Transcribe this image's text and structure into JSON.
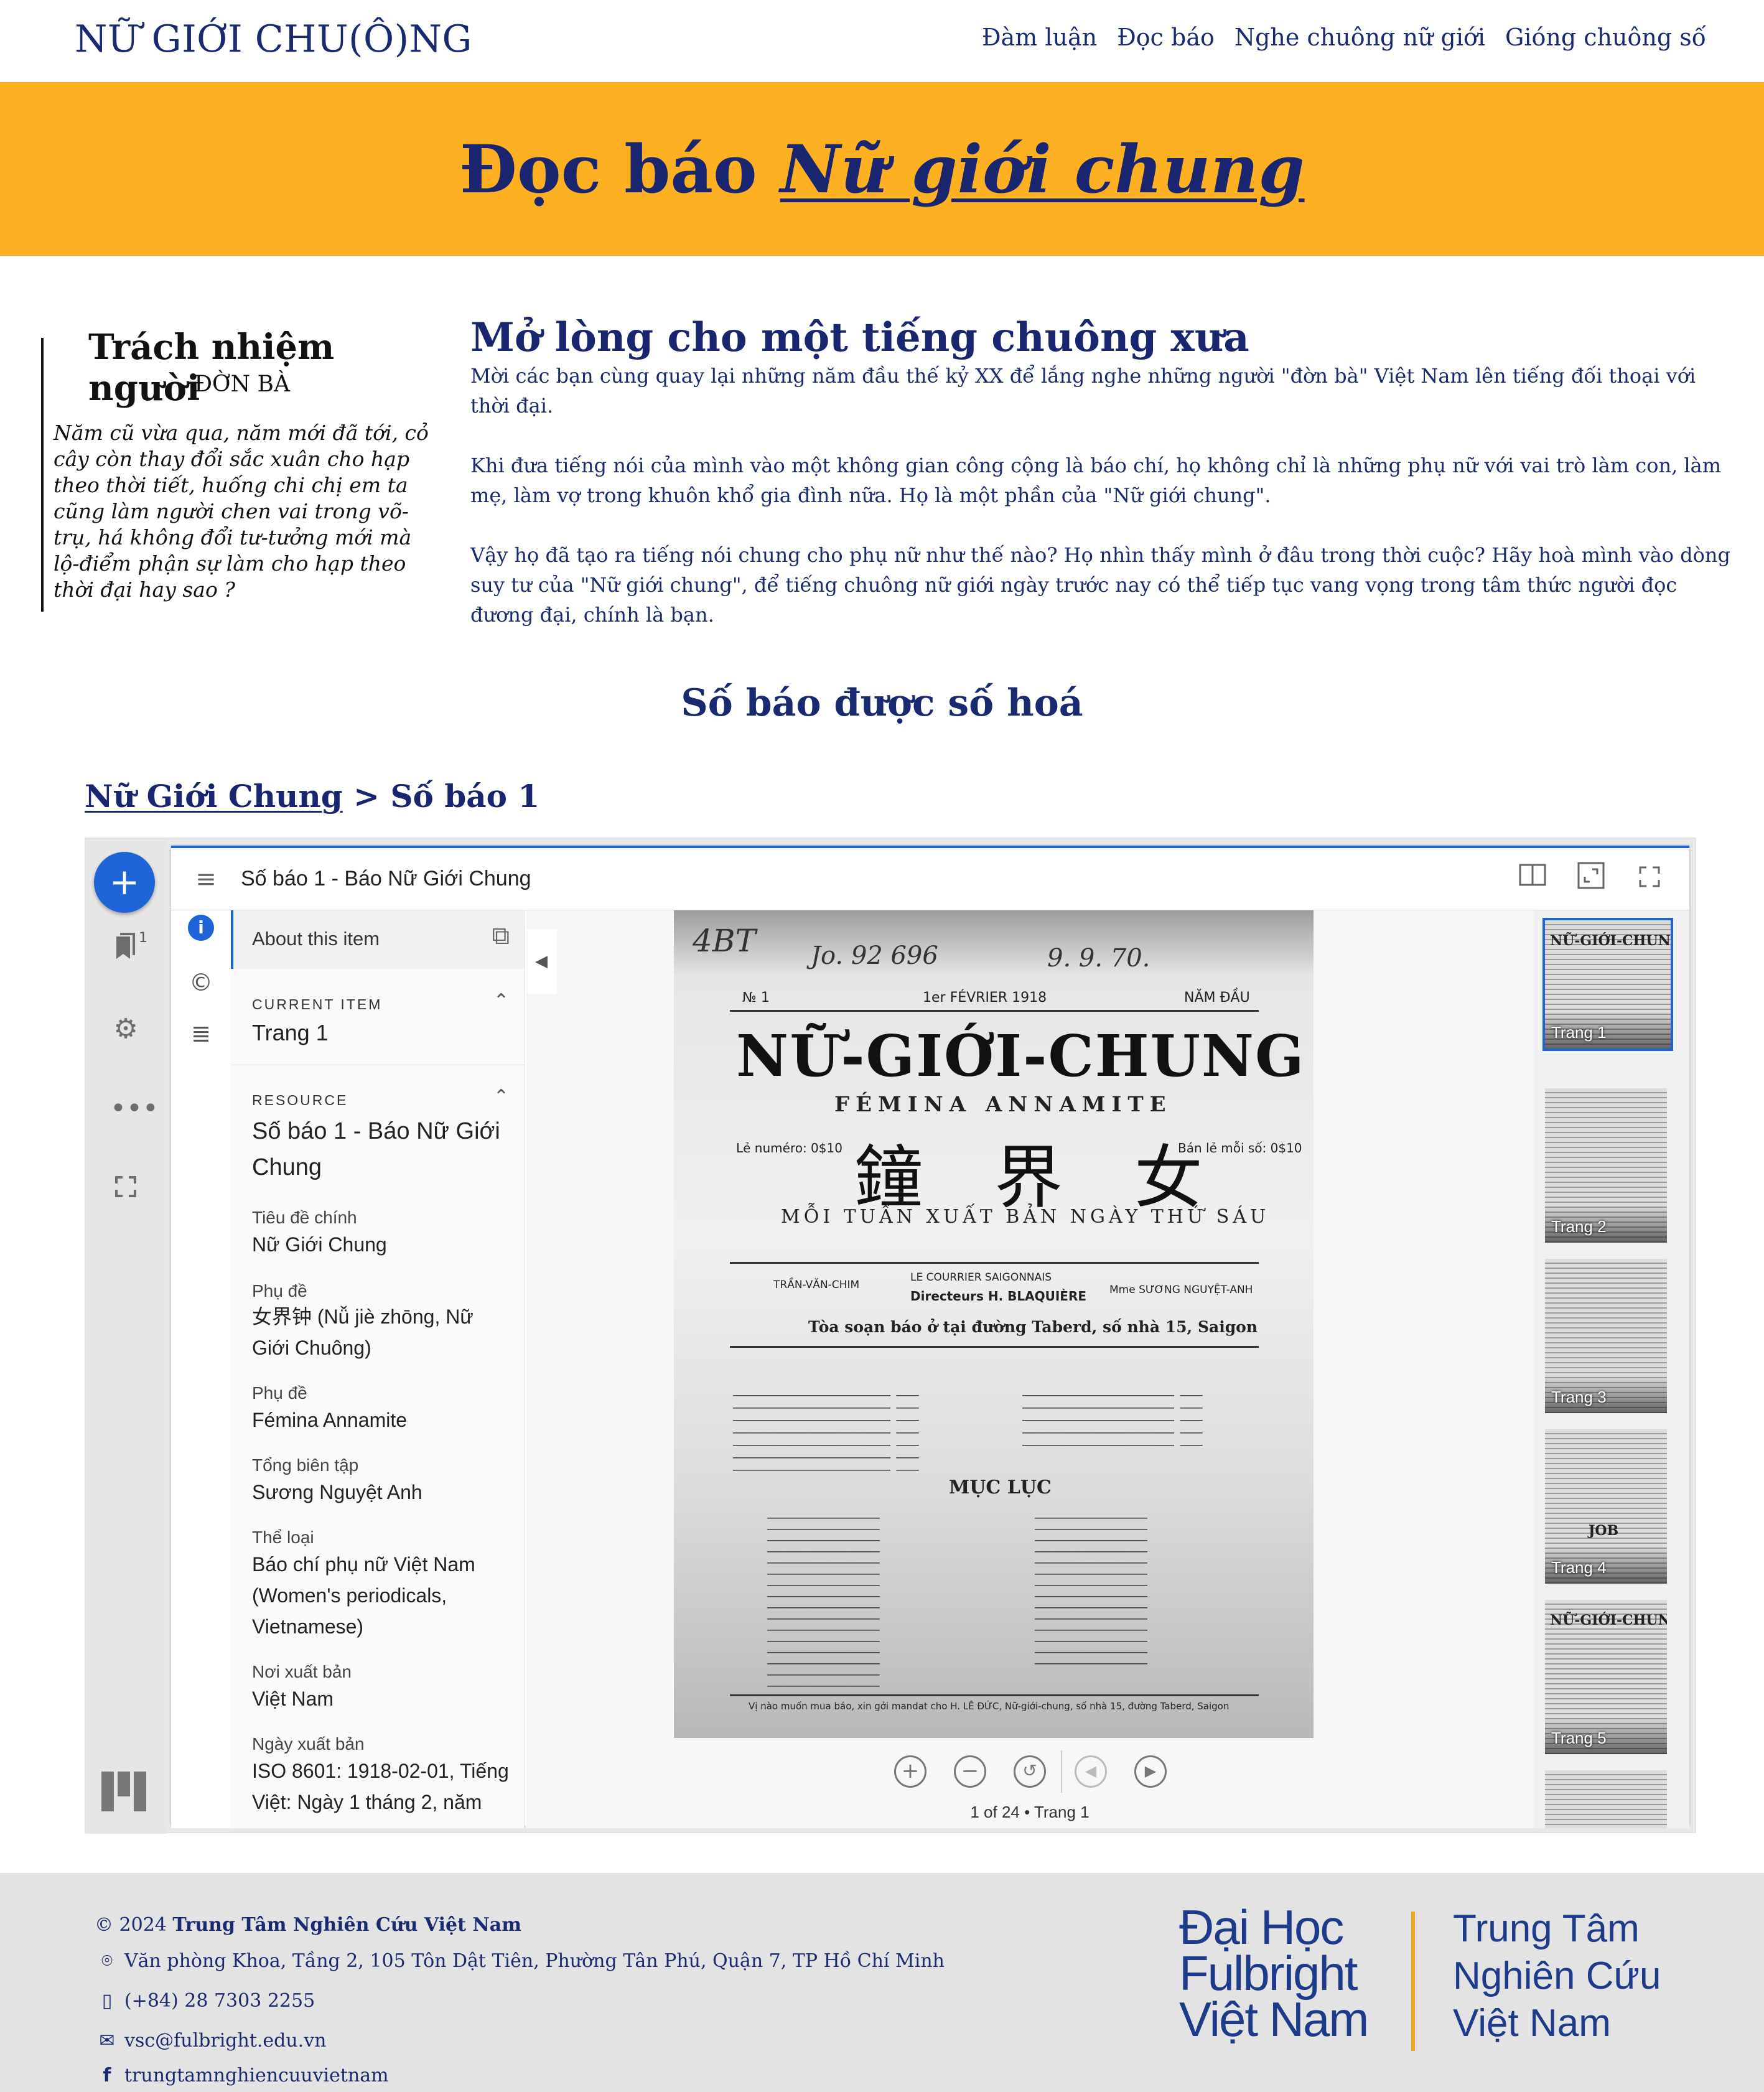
{
  "header": {
    "site_title": "NỮ GIỚI CHU(Ô)NG",
    "nav": [
      "Đàm luận",
      "Đọc báo",
      "Nghe chuông nữ giới",
      "Gióng chuông số"
    ]
  },
  "banner": {
    "prefix": "Đọc báo ",
    "emphasis": "Nữ giới chung",
    "color": "#fdb022"
  },
  "clipping": {
    "title": "Trách nhiệm người",
    "subtitle": "ĐỜN BÀ",
    "body": "Năm cũ vừa qua, năm mới đã tới, cỏ cây còn thay đổi sắc xuân cho hạp theo thời tiết, huống chi chị em ta cũng làm người chen vai trong võ-trụ, há không đổi tư-tưởng mới mà lộ-điểm phận sự làm cho hạp theo thời đại hay sao ?"
  },
  "intro": {
    "heading": "Mở lòng cho một tiếng chuông xưa",
    "paragraphs": [
      "Mời các bạn cùng quay lại những năm đầu thế kỷ XX để lắng nghe những người \"đờn bà\" Việt Nam lên tiếng đối thoại với thời đại.",
      "Khi đưa tiếng nói của mình vào một không gian công cộng là báo chí, họ không chỉ là những phụ nữ với vai trò làm con, làm mẹ, làm vợ trong khuôn khổ gia đình nữa. Họ là một phần của \"Nữ giới chung\".",
      "Vậy họ đã tạo ra tiếng nói chung cho phụ nữ như thế nào? Họ nhìn thấy mình ở đâu trong thời cuộc? Hãy hoà mình vào dòng suy tư của \"Nữ giới chung\", để tiếng chuông nữ giới ngày trước nay có thể tiếp tục vang vọng trong tâm thức người đọc đương đại, chính là bạn."
    ]
  },
  "digitized": {
    "title": "Số báo được số hoá",
    "breadcrumb_link": "Nữ Giới Chung",
    "breadcrumb_sep": " > ",
    "breadcrumb_current": "Số báo 1"
  },
  "viewer": {
    "title": "Số báo 1 - Báo Nữ Giới Chung",
    "rail_badge": "1",
    "accent": "#1f64d6",
    "about_label": "About this item",
    "current_item_header": "CURRENT ITEM",
    "current_item_value": "Trang 1",
    "resource_header": "RESOURCE",
    "resource_title": "Số báo 1 - Báo Nữ Giới Chung",
    "metadata": [
      {
        "label": "Tiêu đề chính",
        "value": "Nữ Giới Chung"
      },
      {
        "label": "Phụ đề",
        "value": "女界钟 (Nǚ jiè zhōng, Nữ Giới Chuông)"
      },
      {
        "label": "Phụ đề",
        "value": "Fémina Annamite"
      },
      {
        "label": "Tổng biên tập",
        "value": "Sương Nguyệt Anh"
      },
      {
        "label": "Thể loại",
        "value": "Báo chí phụ nữ Việt Nam (Women's periodicals, Vietnamese)"
      },
      {
        "label": "Nơi xuất bản",
        "value": "Việt Nam"
      },
      {
        "label": "Ngày xuất bản",
        "value": "ISO 8601: 1918-02-01, Tiếng Việt: Ngày 1 tháng 2, năm"
      }
    ],
    "page_info": "1 of 24 • Trang 1",
    "thumbnails": [
      "Trang 1",
      "Trang 2",
      "Trang 3",
      "Trang 4",
      "Trang 5"
    ],
    "scan": {
      "handwriting_1": "Jo. 92 696",
      "handwriting_2": "9. 9. 70.",
      "number": "№ 1",
      "date": "1er FÉVRIER 1918",
      "year": "NĂM ĐẦU",
      "masthead": "NỮ-GIỚI-CHUNG",
      "subtitle": "FÉMINA ANNAMITE",
      "han": "鐘 界 女",
      "tagline": "MỖI TUẦN XUẤT BẢN NGÀY THỨ SÁU",
      "price_left": "Lẻ numéro: 0$10",
      "price_right": "Bán lẻ mỗi số: 0$10",
      "director": "Directeurs H. BLAQUIÈRE",
      "owner": "LE COURRIER SAIGONNAIS",
      "editor": "TRẦN-VĂN-CHIM",
      "chief": "Mme SƯƠNG NGUYỆT-ANH",
      "address": "Tòa soạn báo ở tại đường Taberd, số nhà 15, Saigon",
      "contents": "MỤC LỤC",
      "footer_line": "Vị nào muốn mua báo, xin gởi mandat cho H. LÊ ĐỨC, Nữ-giới-chung, số nhà 15, đường Taberd, Saigon",
      "thumb_mast": "NỮ-GIỚI-CHUNG",
      "thumb_job": "JOB"
    }
  },
  "footer": {
    "copyright_prefix": "© 2024 ",
    "org": "Trung Tâm Nghiên Cứu Việt Nam",
    "address": "Văn phòng Khoa, Tầng 2, 105 Tôn Dật Tiên, Phường Tân Phú, Quận 7, TP Hồ Chí Minh",
    "phone": "(+84) 28 7303 2255",
    "email": "vsc@fulbright.edu.vn",
    "facebook": "trungtamnghiencuuvietnam",
    "logo_left": [
      "Đại Học",
      "Fulbright",
      "Việt Nam"
    ],
    "logo_right": [
      "Trung Tâm",
      "Nghiên Cứu",
      "Việt Nam"
    ]
  }
}
